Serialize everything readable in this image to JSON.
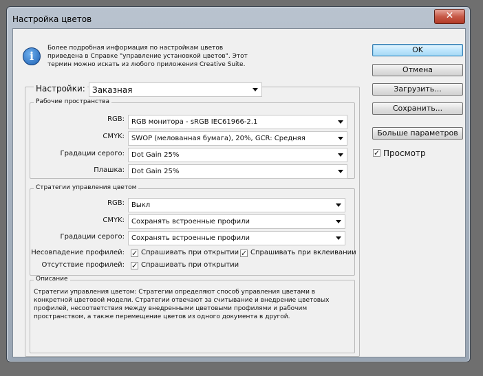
{
  "window": {
    "title": "Настройка цветов",
    "close_glyph": "✕"
  },
  "info": {
    "icon": "info-icon",
    "glyph": "i",
    "lines": [
      "Более подробная информация по настройкам цветов",
      "приведена в Справке \"управление установкой цветов\". Этот",
      "термин можно искать из любого приложения Creative Suite."
    ]
  },
  "settings": {
    "label": "Настройки:",
    "value": "Заказная"
  },
  "workspaces": {
    "legend": "Рабочие пространства",
    "rows": [
      {
        "label": "RGB:",
        "value": "RGB монитора - sRGB IEC61966-2.1"
      },
      {
        "label": "CMYK:",
        "value": "SWOP (мелованная бумага), 20%, GCR: Средняя"
      },
      {
        "label": "Градации серого:",
        "value": "Dot Gain 25%"
      },
      {
        "label": "Плашка:",
        "value": "Dot Gain 25%"
      }
    ]
  },
  "policies": {
    "legend": "Стратегии управления цветом",
    "rows": [
      {
        "label": "RGB:",
        "value": "Выкл"
      },
      {
        "label": "CMYK:",
        "value": "Сохранять встроенные профили"
      },
      {
        "label": "Градации серого:",
        "value": "Сохранять встроенные профили"
      }
    ],
    "mismatch": {
      "label": "Несовпадение профилей:",
      "ask_open": "Спрашивать при открытии",
      "ask_open_checked": true,
      "ask_paste": "Спрашивать при вклеивании",
      "ask_paste_checked": true
    },
    "missing": {
      "label": "Отсутствие профилей:",
      "ask_open": "Спрашивать при открытии",
      "ask_open_checked": true
    }
  },
  "description": {
    "legend": "Описание",
    "lines": [
      "Стратегии управления цветом:  Стратегии определяют способ управления цветами в",
      "конкретной цветовой модели.  Стратегии отвечают за считывание и внедрение цветовых",
      "профилей, несоответствия между внедренными цветовыми профилями и рабочим",
      "пространством, а также перемещение цветов из одного документа в другой."
    ]
  },
  "buttons": {
    "ok": "OK",
    "cancel": "Отмена",
    "load": "Загрузить...",
    "save": "Сохранить...",
    "more": "Больше параметров"
  },
  "preview": {
    "label": "Просмотр",
    "checked": true
  },
  "check_glyph": "✓"
}
